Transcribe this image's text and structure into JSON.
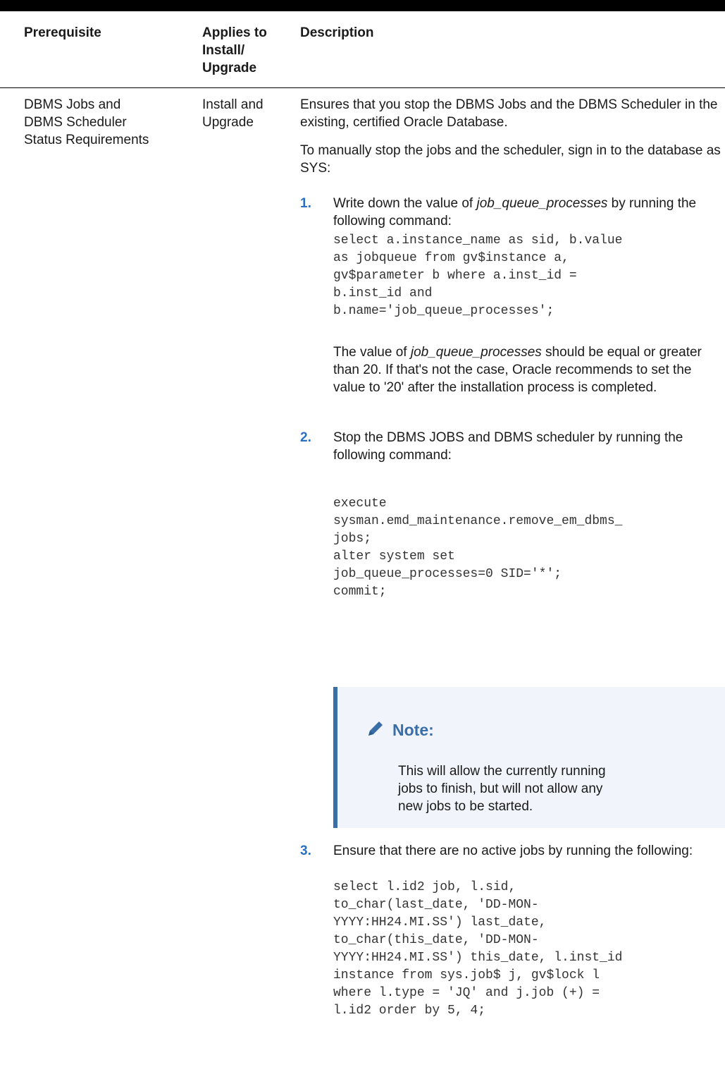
{
  "header": {
    "prerequisite": "Prerequisite",
    "applies_lines": [
      "Applies to",
      "Install/",
      "Upgrade"
    ],
    "description": "Description"
  },
  "row": {
    "prerequisite_lines": [
      "DBMS Jobs and",
      "DBMS Scheduler",
      "Status Requirements"
    ],
    "applies_lines": [
      "Install and",
      "Upgrade"
    ],
    "intro1": "Ensures that you stop the DBMS Jobs and the DBMS Scheduler in the existing, certified Oracle Database.",
    "intro2": "To manually stop the jobs and the scheduler, sign in to the database as SYS:",
    "steps": [
      {
        "number": "1.",
        "text_before": "Write down the value of ",
        "text_em": "job_queue_processes",
        "text_after": " by running the following command:",
        "code": "select a.instance_name as sid, b.value\nas jobqueue from gv$instance a,\ngv$parameter b where a.inst_id =\nb.inst_id and\nb.name='job_queue_processes';",
        "after_before": "The value of ",
        "after_em": "job_queue_processes",
        "after_after": " should be equal or greater than 20. If that's not the case, Oracle recommends to set the value to '20' after the installation process is completed."
      },
      {
        "number": "2.",
        "text": "Stop the DBMS JOBS and DBMS scheduler by running the following command:",
        "code": "execute\nsysman.emd_maintenance.remove_em_dbms_\njobs;\nalter system set\njob_queue_processes=0 SID='*';\ncommit;"
      },
      {
        "number": "3.",
        "text": "Ensure that there are no active jobs by running the following:",
        "code": "select l.id2 job, l.sid,\nto_char(last_date, 'DD-MON-\nYYYY:HH24.MI.SS') last_date,\nto_char(this_date, 'DD-MON-\nYYYY:HH24.MI.SS') this_date, l.inst_id\ninstance from sys.job$ j, gv$lock l\nwhere l.type = 'JQ' and j.job (+) =\nl.id2 order by 5, 4;"
      }
    ],
    "note": {
      "title": "Note:",
      "icon": "pencil-icon",
      "text": "This will allow the currently running jobs to finish, but will not allow any new jobs to be started."
    }
  },
  "colors": {
    "accent": "#2a6fc2",
    "note_border": "#3a6ea8",
    "note_bg": "#f1f5fb"
  }
}
